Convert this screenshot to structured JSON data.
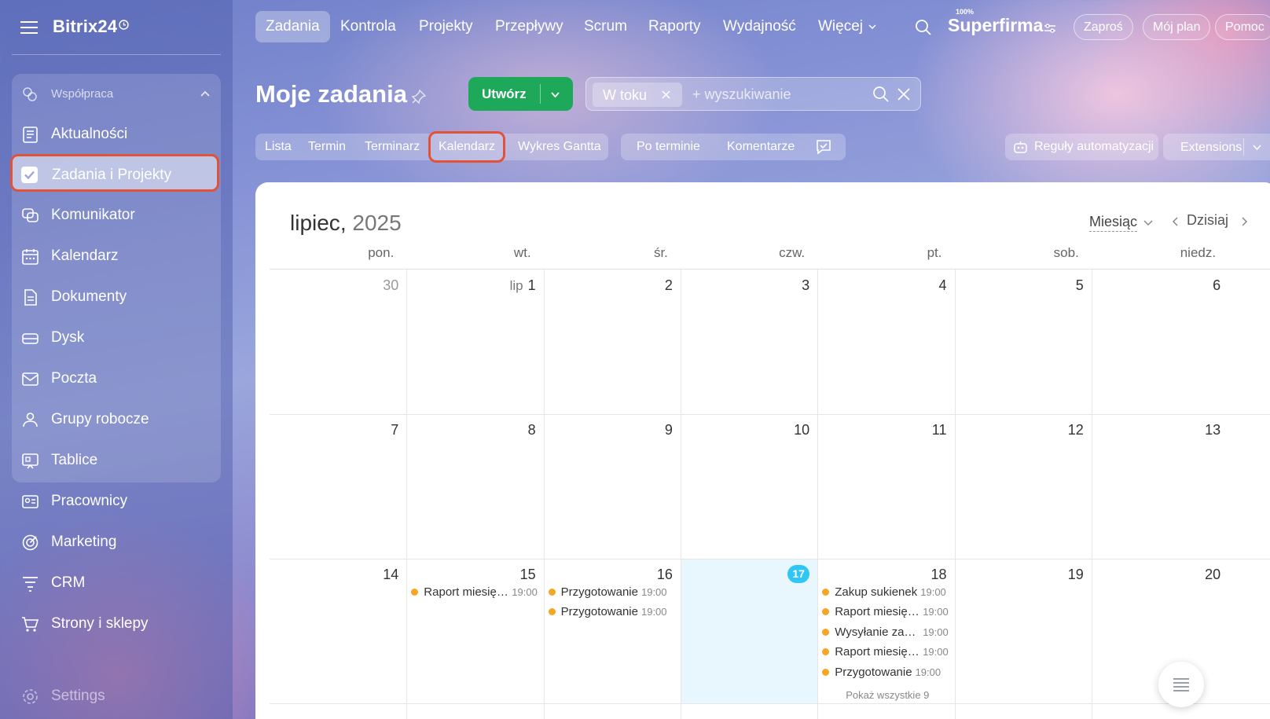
{
  "app": {
    "name": "Bitrix24"
  },
  "sidebar": {
    "group_label": "Współpraca",
    "items": [
      {
        "label": "Aktualności",
        "icon": "news-icon"
      },
      {
        "label": "Zadania i Projekty",
        "icon": "checkbox-icon",
        "active": true
      },
      {
        "label": "Komunikator",
        "icon": "chat-icon"
      },
      {
        "label": "Kalendarz",
        "icon": "calendar-icon"
      },
      {
        "label": "Dokumenty",
        "icon": "document-icon"
      },
      {
        "label": "Dysk",
        "icon": "disk-icon"
      },
      {
        "label": "Poczta",
        "icon": "mail-icon"
      },
      {
        "label": "Grupy robocze",
        "icon": "users-icon"
      },
      {
        "label": "Tablice",
        "icon": "board-icon"
      },
      {
        "label": "Pracownicy",
        "icon": "employees-icon"
      },
      {
        "label": "Marketing",
        "icon": "target-icon"
      },
      {
        "label": "CRM",
        "icon": "funnel-icon"
      },
      {
        "label": "Strony i sklepy",
        "icon": "cart-icon"
      },
      {
        "label": "Settings",
        "icon": "gear-icon"
      }
    ]
  },
  "topnav": {
    "tabs": [
      "Zadania",
      "Kontrola",
      "Projekty",
      "Przepływy",
      "Scrum",
      "Raporty",
      "Wydajność",
      "Więcej"
    ],
    "efficiency_badge": "100%",
    "company": "Superfirma",
    "invite": "Zaproś",
    "plan": "Mój plan",
    "help": "Pomoc"
  },
  "header": {
    "title": "Moje zadania",
    "create_label": "Utwórz",
    "filter_chip": "W toku",
    "search_placeholder": "+ wyszukiwanie"
  },
  "views": {
    "items": [
      "Lista",
      "Termin",
      "Terminarz",
      "Kalendarz",
      "Wykres Gantta"
    ],
    "active": "Kalendarz",
    "sort": "Po terminie",
    "comments": "Komentarze",
    "automation": "Reguły automatyzacji",
    "extensions": "Extensions"
  },
  "calendar": {
    "month": "lipiec",
    "year": "2025",
    "view_mode": "Miesiąc",
    "today_label": "Dzisiaj",
    "weekdays": [
      "pon.",
      "wt.",
      "śr.",
      "czw.",
      "pt.",
      "sob.",
      "niedz."
    ],
    "month_abbr": "lip",
    "weeks": [
      [
        "30",
        "1",
        "2",
        "3",
        "4",
        "5",
        "6"
      ],
      [
        "7",
        "8",
        "9",
        "10",
        "11",
        "12",
        "13"
      ],
      [
        "14",
        "15",
        "16",
        "17",
        "18",
        "19",
        "20"
      ]
    ],
    "today": "17",
    "events": {
      "15": [
        {
          "title": "Raport miesięczny",
          "time": "19:00"
        }
      ],
      "16": [
        {
          "title": "Przygotowanie",
          "time": "19:00"
        },
        {
          "title": "Przygotowanie",
          "time": "19:00"
        }
      ],
      "18": [
        {
          "title": "Zakup sukienek",
          "time": "19:00"
        },
        {
          "title": "Raport miesięczny",
          "time": "19:00"
        },
        {
          "title": "Wysyłanie zaproszeń",
          "time": "19:00"
        },
        {
          "title": "Raport miesięczny",
          "time": "19:00"
        },
        {
          "title": "Przygotowanie",
          "time": "19:00"
        }
      ]
    },
    "show_all": "Pokaż wszystkie 9"
  },
  "colors": {
    "accent_green": "#1ea85a",
    "highlight_red": "#e0523a",
    "today_blue": "#2fc6f6",
    "event_dot": "#f5a623"
  }
}
